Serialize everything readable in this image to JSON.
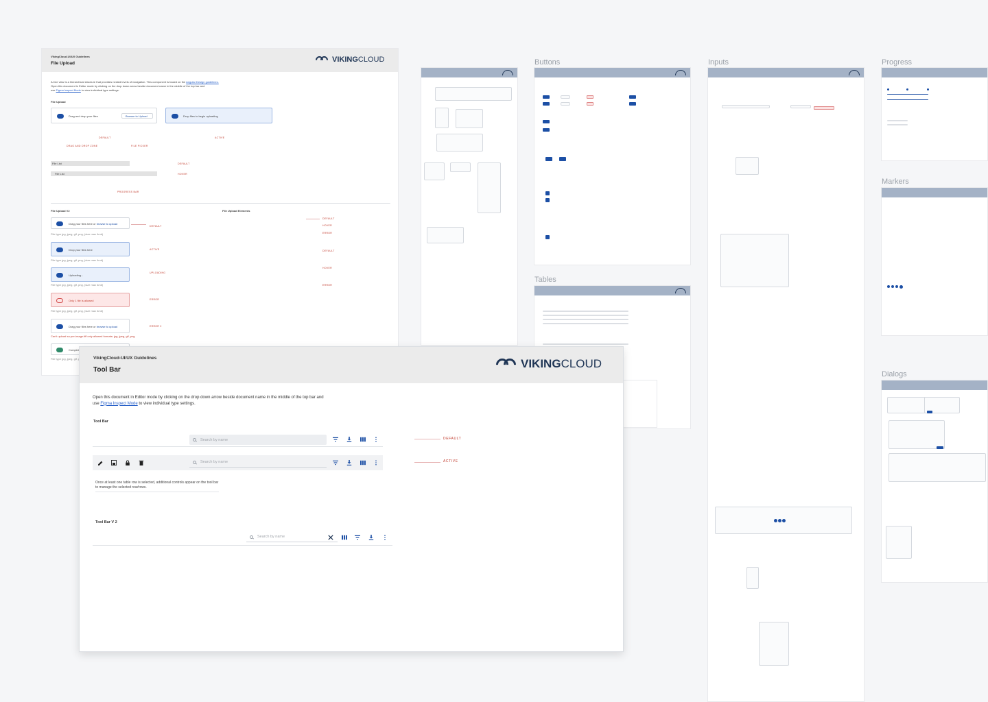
{
  "sections": {
    "buttons": "Buttons",
    "inputs": "Inputs",
    "progress": "Progress",
    "tables": "Tables",
    "markers": "Markers",
    "dialogs": "Dialogs"
  },
  "file_upload": {
    "org": "VikingCloud-UI/UX Guidelines",
    "title": "File Upload",
    "brand_bold": "VIKING",
    "brand_light": "CLOUD",
    "desc_1": "A tree view is a hierarchical structure that provides nested levels of navigation. This component is based on the",
    "desc_link": "Angular Design guidelines.",
    "desc_2": "Open this document in Editor mode by clicking on the drop down arrow beside document name in the middle of the top bar and",
    "desc_3a": "use",
    "desc_3_link": "Figma Inspect Mode",
    "desc_3b": "to view individual type settings.",
    "section_1": "File Upload",
    "drag_drop": "Drag and drop your files",
    "browse_btn": "Browse to Upload",
    "drop_begin": "Drop files to begin uploading",
    "label_default": "DEFAULT",
    "label_drag_zone": "DRAG AND DROP ZONE",
    "label_file_picker": "FILE PICKER",
    "label_active": "ACTIVE",
    "file_list_1": "File List",
    "file_list_2": "File List",
    "label_default2": "DEFAULT",
    "label_hover": "HOVER",
    "label_progress_bar": "PROGRESS BAR",
    "section_v2": "File Upload V2",
    "section_elements": "File Upload Elements",
    "v2_drag": "Drag your files here or",
    "v2_browse": "browse to upload",
    "v2_hint": "File type jpg, jpeg, gif, png, (size max 4mb)",
    "v2_drop": "Drop your files here",
    "v2_uploading": "Uploading...",
    "v2_only_one": "Only 1 file is allowed",
    "v2_error_hint": "Can't upload su-per-image.tiff only allowed formats: jpg, jpeg, gif, png",
    "v2_complete": "Complet",
    "v2_labels": [
      "DEFAULT",
      "ACTIVE",
      "UPLOADING",
      "ERROR",
      "ERROR 2"
    ],
    "el_labels": [
      "DEFAULT",
      "HOVER",
      "ERROR",
      "DEFAULT",
      "HOVER",
      "ERROR"
    ]
  },
  "toolbar": {
    "org": "VikingCloud-UI/UX Guidelines",
    "title": "Tool Bar",
    "brand_bold": "VIKING",
    "brand_light": "CLOUD",
    "desc_1": "Open this document in Editor mode by clicking on the drop down arrow beside document name in the middle of the top bar and",
    "desc_2a": "use",
    "desc_2_link": "Figma Inspect Mode",
    "desc_2b": "to view individual type settings.",
    "section_1": "Tool Bar",
    "search_placeholder": "Search by name",
    "state_default": "DEFAULT",
    "state_active": "ACTIVE",
    "note": "Once at least one table row is selected, additional controls appear on the tool bar to manage the selected row/rows.",
    "section_2": "Tool Bar V 2",
    "search_placeholder_v2": "Search by name"
  },
  "colors": {
    "brand_navy": "#1f3555",
    "primary_blue": "#1c4fa5",
    "state_red": "#c0392b",
    "board_header": "#a4b2c6"
  }
}
